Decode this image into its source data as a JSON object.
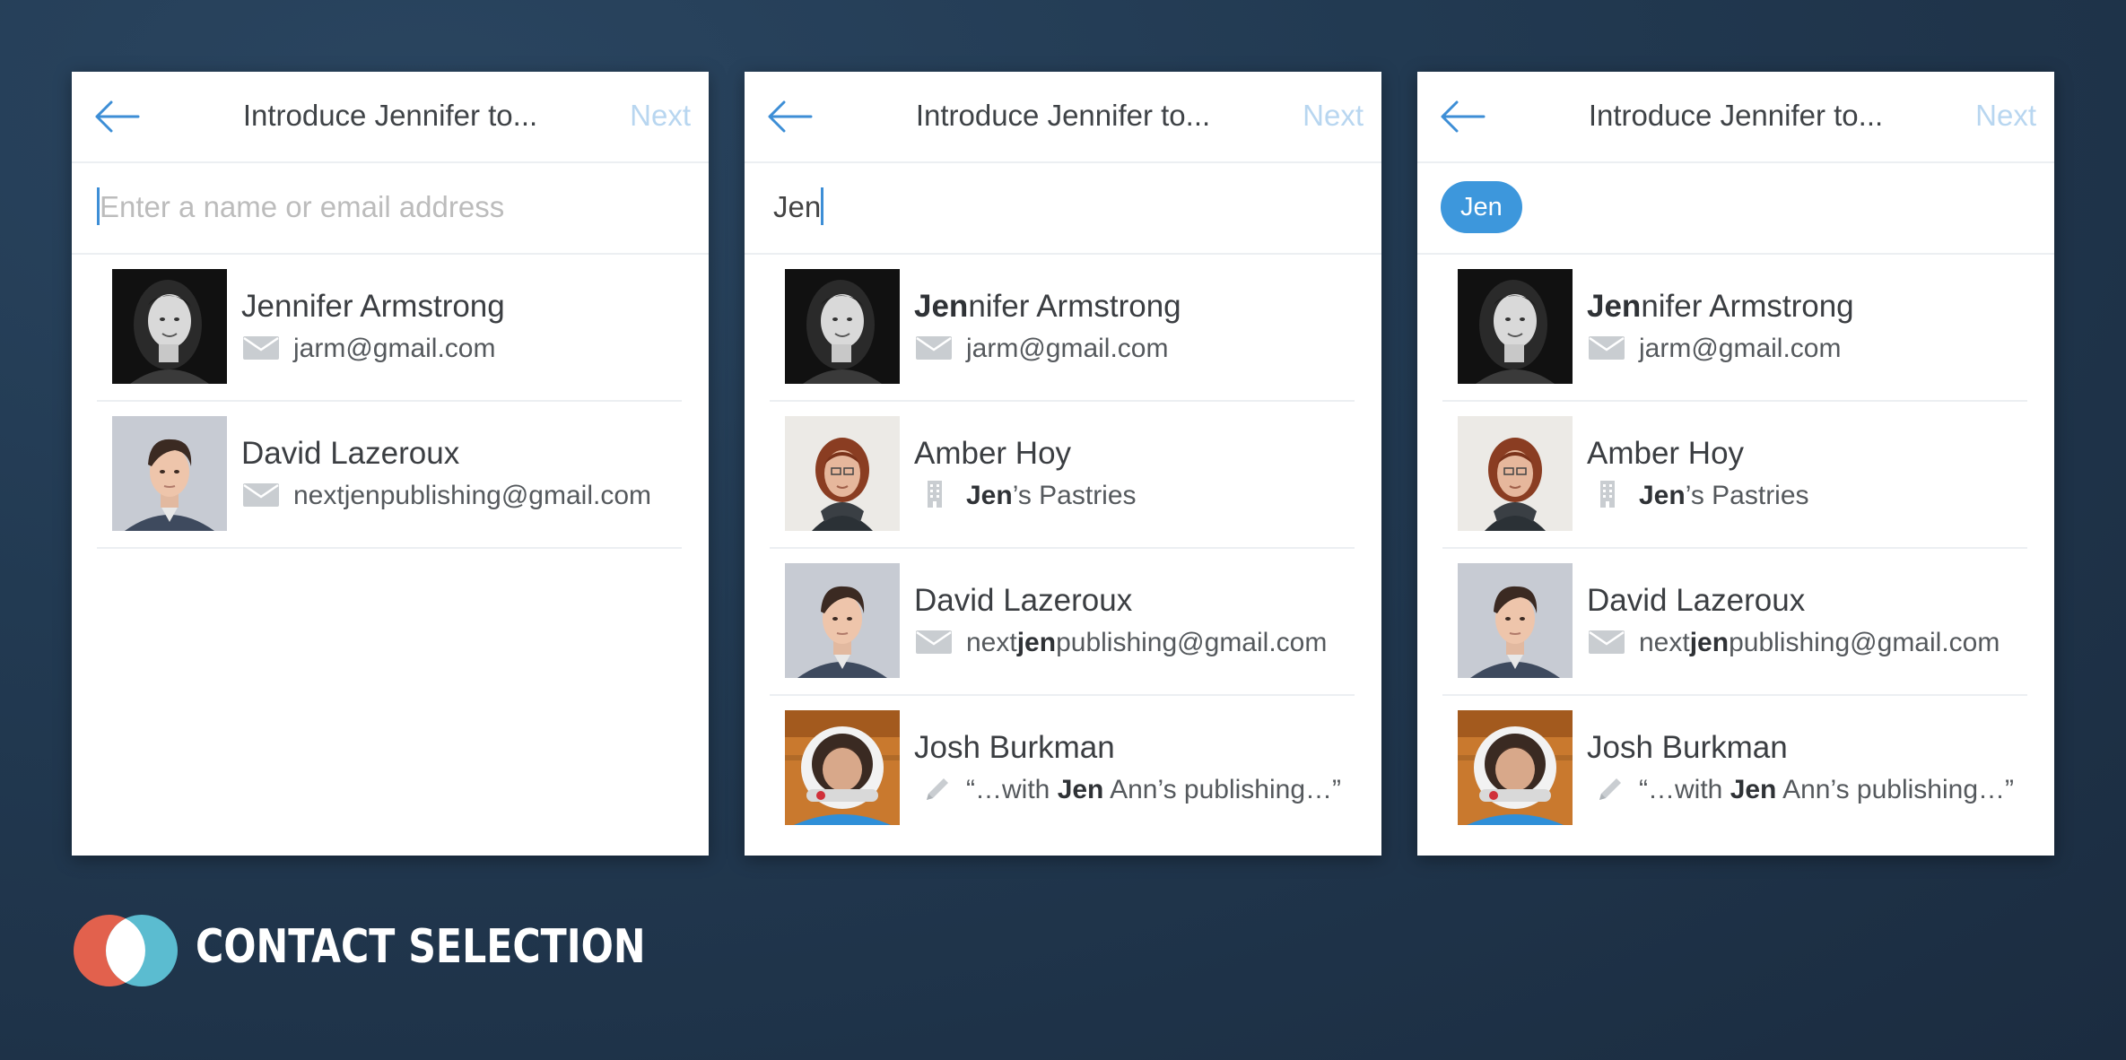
{
  "panels": [
    {
      "title": "Introduce Jennifer to...",
      "next_label": "Next",
      "input": {
        "value": "",
        "placeholder": "Enter a name or email address",
        "chip": ""
      },
      "contacts": [
        {
          "name_bold": "",
          "name_rest": "Jennifer Armstrong",
          "detail_icon": "mail-icon",
          "detail_pre": "",
          "detail_bold": "",
          "detail_post": "jarm@gmail.com",
          "avatar": "jennifer"
        },
        {
          "name_bold": "",
          "name_rest": "David Lazeroux",
          "detail_icon": "mail-icon",
          "detail_pre": "",
          "detail_bold": "",
          "detail_post": "nextjenpublishing@gmail.com",
          "avatar": "david"
        }
      ]
    },
    {
      "title": "Introduce Jennifer to...",
      "next_label": "Next",
      "input": {
        "value": "Jen",
        "placeholder": "",
        "chip": ""
      },
      "contacts": [
        {
          "name_bold": "Jen",
          "name_rest": "nifer Armstrong",
          "detail_icon": "mail-icon",
          "detail_pre": "",
          "detail_bold": "",
          "detail_post": "jarm@gmail.com",
          "avatar": "jennifer"
        },
        {
          "name_bold": "",
          "name_rest": "Amber Hoy",
          "detail_icon": "building-icon",
          "detail_pre": "",
          "detail_bold": "Jen",
          "detail_post": "’s Pastries",
          "avatar": "amber"
        },
        {
          "name_bold": "",
          "name_rest": "David Lazeroux",
          "detail_icon": "mail-icon",
          "detail_pre": "next",
          "detail_bold": "jen",
          "detail_post": "publishing@gmail.com",
          "avatar": "david"
        },
        {
          "name_bold": "",
          "name_rest": "Josh Burkman",
          "detail_icon": "pencil-icon",
          "detail_pre": "“…with ",
          "detail_bold": "Jen",
          "detail_post": " Ann’s publishing…”",
          "avatar": "josh"
        }
      ]
    },
    {
      "title": "Introduce Jennifer to...",
      "next_label": "Next",
      "input": {
        "value": "",
        "placeholder": "",
        "chip": "Jen"
      },
      "contacts": [
        {
          "name_bold": "Jen",
          "name_rest": "nifer Armstrong",
          "detail_icon": "mail-icon",
          "detail_pre": "",
          "detail_bold": "",
          "detail_post": "jarm@gmail.com",
          "avatar": "jennifer"
        },
        {
          "name_bold": "",
          "name_rest": "Amber Hoy",
          "detail_icon": "building-icon",
          "detail_pre": "",
          "detail_bold": "Jen",
          "detail_post": "’s Pastries",
          "avatar": "amber"
        },
        {
          "name_bold": "",
          "name_rest": "David Lazeroux",
          "detail_icon": "mail-icon",
          "detail_pre": "next",
          "detail_bold": "jen",
          "detail_post": "publishing@gmail.com",
          "avatar": "david"
        },
        {
          "name_bold": "",
          "name_rest": "Josh Burkman",
          "detail_icon": "pencil-icon",
          "detail_pre": "“…with ",
          "detail_bold": "Jen",
          "detail_post": " Ann’s publishing…”",
          "avatar": "josh"
        }
      ]
    }
  ],
  "footer": {
    "label": "CONTACT SELECTION"
  },
  "colors": {
    "accent": "#3d97dc",
    "next_disabled": "#b8d6f0",
    "brand_red": "#e2614d",
    "brand_teal": "#5bbcd0"
  }
}
